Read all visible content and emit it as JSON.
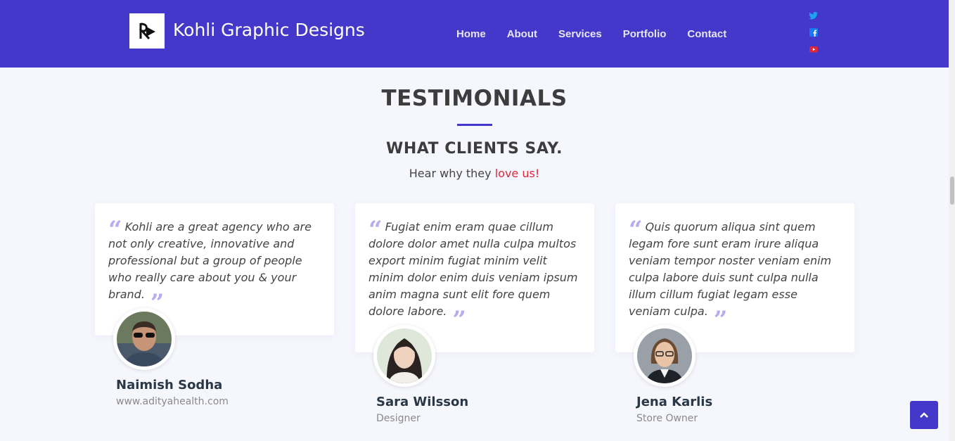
{
  "header": {
    "brand": "Kohli Graphic Designs",
    "nav": [
      "Home",
      "About",
      "Services",
      "Portfolio",
      "Contact"
    ],
    "social": [
      {
        "icon": "twitter-icon",
        "color": "#1da1f2"
      },
      {
        "icon": "facebook-icon",
        "color": "#1877f2"
      },
      {
        "icon": "youtube-icon",
        "color": "#e0263b"
      }
    ],
    "bg_color": "#4338c9"
  },
  "section": {
    "title": "TESTIMONIALS",
    "subtitle": "WHAT CLIENTS SAY.",
    "hear_prefix": "Hear why they ",
    "hear_highlight": "love us!"
  },
  "testimonials": [
    {
      "quote": "Kohli are a great agency who are not only creative, innovative and professional but a group of people who really care about you & your brand.",
      "name": "Naimish Sodha",
      "role": "www.adityahealth.com"
    },
    {
      "quote": "Fugiat enim eram quae cillum dolore dolor amet nulla culpa multos export minim fugiat minim velit minim dolor enim duis veniam ipsum anim magna sunt elit fore quem dolore labore.",
      "name": "Sara Wilsson",
      "role": "Designer"
    },
    {
      "quote": "Quis quorum aliqua sint quem legam fore sunt eram irure aliqua veniam tempor noster veniam enim culpa labore duis sunt culpa nulla illum cillum fugiat legam esse veniam culpa.",
      "name": "Jena Karlis",
      "role": "Store Owner"
    }
  ],
  "accent_color": "#4338c9",
  "quote_mark_color": "#b4adf0"
}
